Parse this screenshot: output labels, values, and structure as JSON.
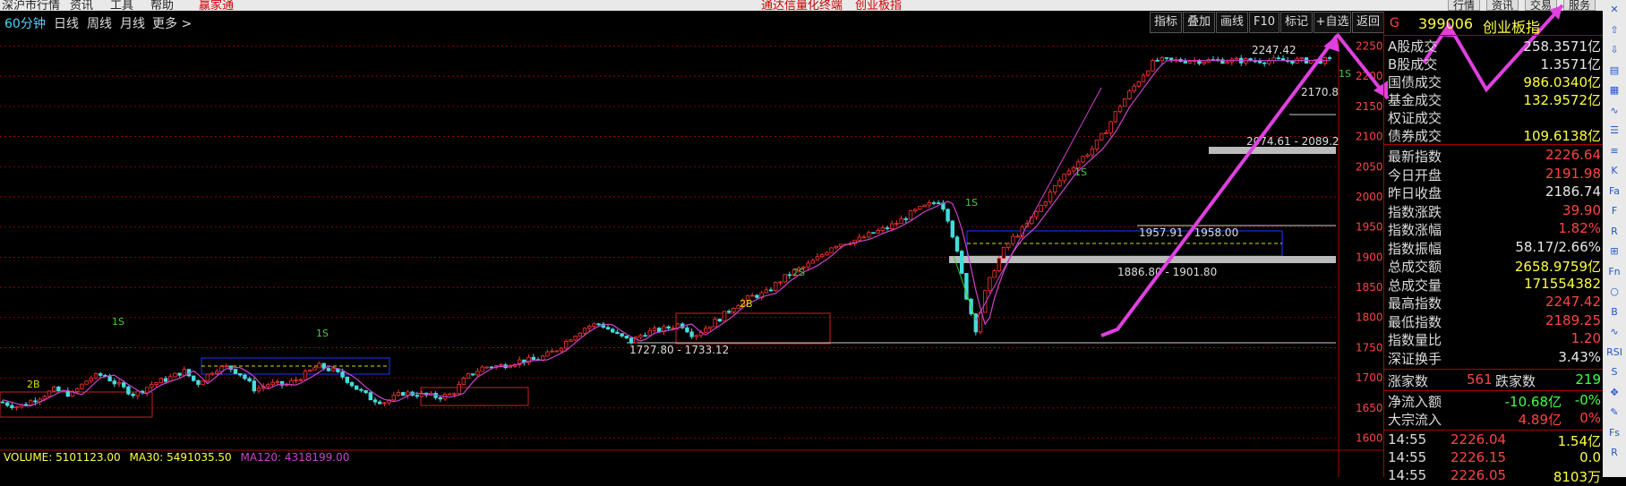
{
  "menu": {
    "items": [
      "深沪市行情",
      "资讯",
      "工具",
      "帮助",
      "赢家通"
    ],
    "center": [
      "通达信量化终端",
      "创业板指"
    ],
    "right_buttons": [
      "行情",
      "资讯",
      "交易",
      "服务"
    ]
  },
  "period_tabs": [
    "60分钟",
    "日线",
    "周线",
    "月线",
    "更多 >"
  ],
  "toolbar": [
    "指标",
    "叠加",
    "画线",
    "F10",
    "标记",
    "+自选",
    "返回"
  ],
  "chart_data": {
    "type": "candlestick",
    "period": "60分钟",
    "y_ticks": [
      2250,
      2200,
      2150,
      2100,
      2050,
      2000,
      1950,
      1900,
      1850,
      1800,
      1750,
      1700,
      1650,
      1600
    ],
    "ylim": [
      1580,
      2270
    ],
    "annotations": {
      "high_label": "2247.42",
      "level_2170": "2170.8",
      "zone_top": "2074.61 - 2089.2",
      "zone_mid": "1957.91 - 1958.00",
      "zone_low": "1886.80 - 1901.80",
      "zone_left": "1727.80 - 1733.12"
    },
    "markers": [
      "1S",
      "2B",
      "1S",
      "2S",
      "2B",
      "1S",
      "1S",
      "1S"
    ],
    "close_path": [
      [
        0,
        1660
      ],
      [
        20,
        1652
      ],
      [
        40,
        1665
      ],
      [
        60,
        1680
      ],
      [
        80,
        1672
      ],
      [
        100,
        1700
      ],
      [
        115,
        1705
      ],
      [
        130,
        1690
      ],
      [
        150,
        1672
      ],
      [
        170,
        1690
      ],
      [
        190,
        1700
      ],
      [
        205,
        1712
      ],
      [
        220,
        1690
      ],
      [
        240,
        1715
      ],
      [
        255,
        1718
      ],
      [
        270,
        1705
      ],
      [
        285,
        1680
      ],
      [
        300,
        1690
      ],
      [
        320,
        1688
      ],
      [
        340,
        1705
      ],
      [
        355,
        1720
      ],
      [
        370,
        1713
      ],
      [
        385,
        1700
      ],
      [
        400,
        1680
      ],
      [
        415,
        1665
      ],
      [
        430,
        1660
      ],
      [
        450,
        1675
      ],
      [
        470,
        1672
      ],
      [
        490,
        1668
      ],
      [
        505,
        1673
      ],
      [
        520,
        1700
      ],
      [
        540,
        1718
      ],
      [
        560,
        1720
      ],
      [
        580,
        1728
      ],
      [
        600,
        1730
      ],
      [
        620,
        1745
      ],
      [
        640,
        1770
      ],
      [
        655,
        1785
      ],
      [
        670,
        1790
      ],
      [
        690,
        1770
      ],
      [
        705,
        1760
      ],
      [
        720,
        1775
      ],
      [
        740,
        1780
      ],
      [
        760,
        1790
      ],
      [
        775,
        1770
      ],
      [
        790,
        1785
      ],
      [
        805,
        1800
      ],
      [
        820,
        1820
      ],
      [
        840,
        1835
      ],
      [
        855,
        1840
      ],
      [
        870,
        1860
      ],
      [
        885,
        1875
      ],
      [
        900,
        1885
      ],
      [
        915,
        1900
      ],
      [
        930,
        1920
      ],
      [
        945,
        1925
      ],
      [
        960,
        1930
      ],
      [
        975,
        1940
      ],
      [
        990,
        1948
      ],
      [
        1005,
        1960
      ],
      [
        1020,
        1975
      ],
      [
        1035,
        1985
      ],
      [
        1050,
        1995
      ],
      [
        1060,
        1960
      ],
      [
        1070,
        1900
      ],
      [
        1080,
        1830
      ],
      [
        1090,
        1780
      ],
      [
        1100,
        1840
      ],
      [
        1110,
        1880
      ],
      [
        1120,
        1910
      ],
      [
        1130,
        1930
      ],
      [
        1145,
        1950
      ],
      [
        1160,
        1980
      ],
      [
        1175,
        2010
      ],
      [
        1190,
        2040
      ],
      [
        1205,
        2060
      ],
      [
        1220,
        2080
      ],
      [
        1235,
        2110
      ],
      [
        1250,
        2150
      ],
      [
        1260,
        2170
      ],
      [
        1270,
        2190
      ],
      [
        1280,
        2210
      ],
      [
        1290,
        2226
      ]
    ]
  },
  "volume_line": {
    "volume_label": "VOLUME: 5101123.00",
    "ma30_label": "MA30: 5491035.50",
    "ma120_label": "MA120: 4318199.00"
  },
  "side": {
    "code": "399006",
    "name": "创业板指",
    "g": "G",
    "rows_a": [
      {
        "l": "A股成交",
        "v": "258.3571亿",
        "c": "#e8e8e8"
      },
      {
        "l": "B股成交",
        "v": "1.3571亿",
        "c": "#e8e8e8"
      },
      {
        "l": "国债成交",
        "v": "986.0340亿",
        "c": "#ffff44"
      },
      {
        "l": "基金成交",
        "v": "132.9572亿",
        "c": "#ffff44"
      },
      {
        "l": "权证成交",
        "v": "",
        "c": "#ffff44"
      },
      {
        "l": "债券成交",
        "v": "109.6138亿",
        "c": "#ffff44"
      }
    ],
    "rows_b": [
      {
        "l": "最新指数",
        "v": "2226.64",
        "c": "#ff4444"
      },
      {
        "l": "今日开盘",
        "v": "2191.98",
        "c": "#ff4444"
      },
      {
        "l": "昨日收盘",
        "v": "2186.74",
        "c": "#e8e8e8"
      },
      {
        "l": "指数涨跌",
        "v": "39.90",
        "c": "#ff4444"
      },
      {
        "l": "指数涨幅",
        "v": "1.82%",
        "c": "#ff4444"
      },
      {
        "l": "指数振幅",
        "v": "58.17/2.66%",
        "c": "#e8e8e8"
      },
      {
        "l": "总成交额",
        "v": "2658.9759亿",
        "c": "#ffff44"
      },
      {
        "l": "总成交量",
        "v": "171554382",
        "c": "#ffff44"
      },
      {
        "l": "最高指数",
        "v": "2247.42",
        "c": "#ff4444"
      },
      {
        "l": "最低指数",
        "v": "2189.25",
        "c": "#ff4444"
      },
      {
        "l": "指数量比",
        "v": "1.20",
        "c": "#ff4444"
      },
      {
        "l": "深证换手",
        "v": "3.43%",
        "c": "#e8e8e8"
      }
    ],
    "updown": {
      "up_label": "涨家数",
      "up": "561",
      "down_label": "跌家数",
      "down": "219"
    },
    "flow": [
      {
        "l": "净流入额",
        "v": "-10.68亿",
        "p": "-0%",
        "c": "#44ff44"
      },
      {
        "l": "大宗流入",
        "v": "4.89亿",
        "p": "0%",
        "c": "#ff4444"
      }
    ],
    "ticks": [
      {
        "t": "14:55",
        "p": "2226.04",
        "v": "1.54亿"
      },
      {
        "t": "14:55",
        "p": "2226.15",
        "v": "0.0"
      },
      {
        "t": "14:55",
        "p": "2226.05",
        "v": "8103万"
      }
    ]
  },
  "right_icons": [
    "close-icon",
    "up-arrow-icon",
    "down-arrow-icon",
    "chart-icon",
    "grid-icon",
    "line-icon",
    "list-icon",
    "menu-icon",
    "k-icon",
    "fa-icon",
    "fin-icon",
    "r-icon",
    "kbar-icon",
    "fn-icon",
    "circle-icon",
    "b-icon",
    "wave-icon",
    "rsi-icon",
    "s-icon",
    "move-icon",
    "pen-icon",
    "fs-icon",
    "rt-icon"
  ],
  "colors": {
    "up": "#ff3333",
    "down": "#44dddd",
    "ma": "#cc44cc",
    "grid": "#aa0000",
    "arrow": "#e040e0"
  }
}
